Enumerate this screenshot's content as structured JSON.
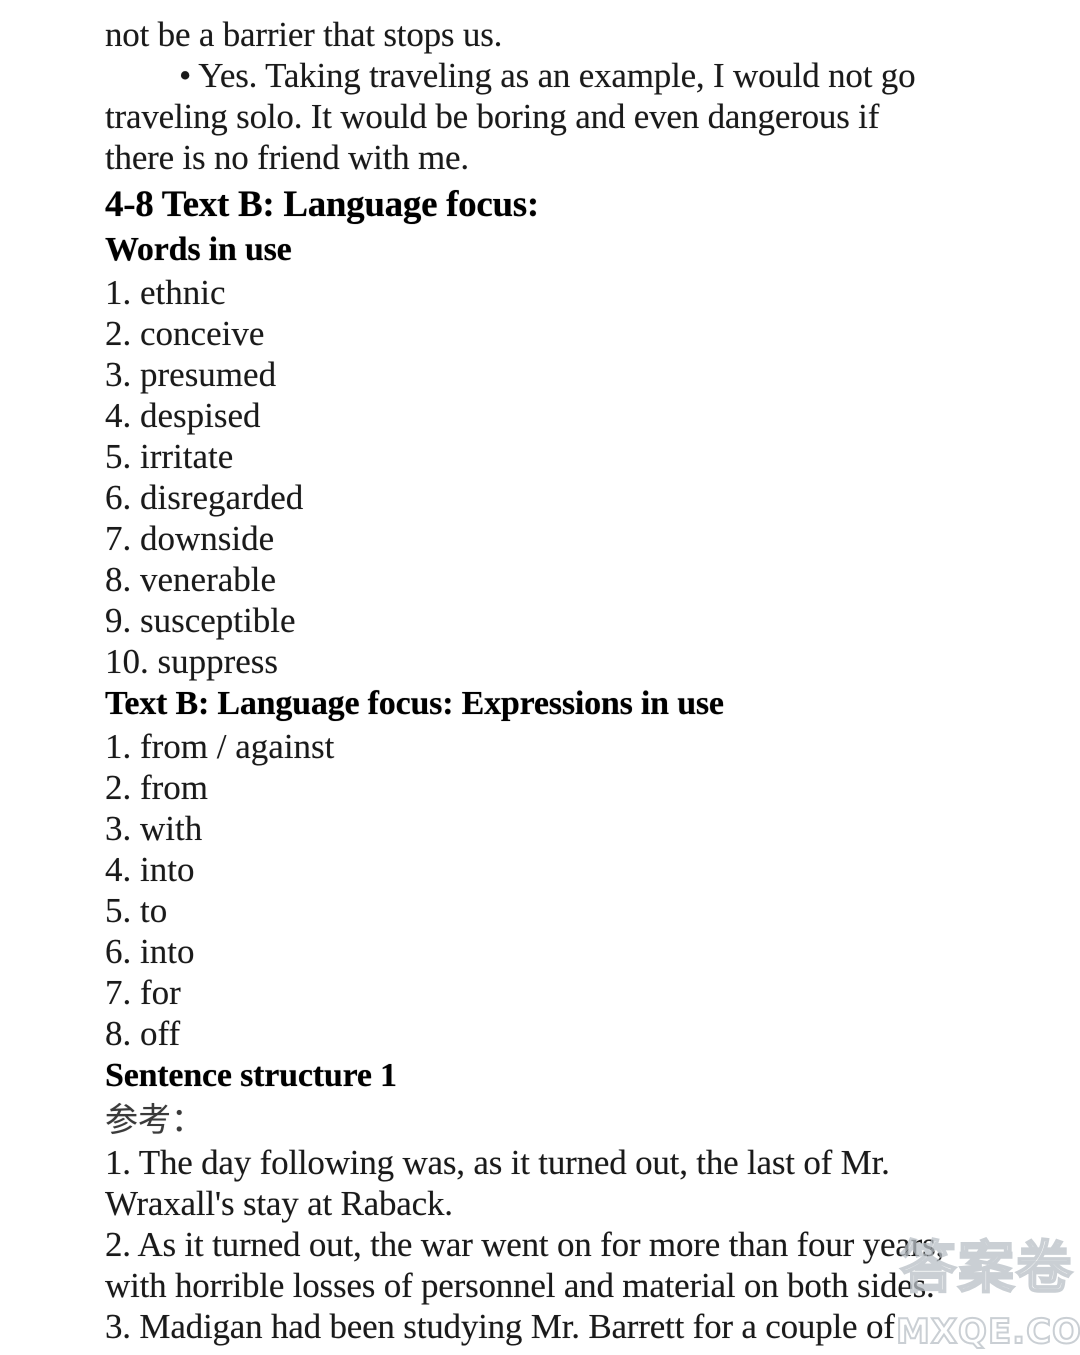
{
  "document": {
    "continued_paragraph": {
      "line1": "not be a barrier that stops us.",
      "bullet_line": "• Yes. Taking traveling as an example, I would not go",
      "line3": "traveling solo. It would be boring and even dangerous if",
      "line4": "there is no friend with me."
    },
    "section_heading": "4-8 Text B: Language focus:",
    "words_in_use": {
      "heading": "Words in use",
      "items": [
        "1. ethnic",
        "2. conceive",
        "3. presumed",
        "4. despised",
        "5. irritate",
        "6. disregarded",
        "7. downside",
        "8. venerable",
        "9. susceptible",
        "10. suppress"
      ]
    },
    "expressions_in_use": {
      "heading": "Text B: Language focus: Expressions in use",
      "items": [
        "1. from / against",
        "2. from",
        "3. with",
        "4. into",
        "5. to",
        "6. into",
        "7. for",
        "8. off"
      ]
    },
    "sentence_structure": {
      "heading": "Sentence structure 1",
      "note": "参考：",
      "answers": [
        {
          "line1": "1. The day following was, as it turned out, the last of Mr.",
          "line2": "Wraxall's stay at Raback."
        },
        {
          "line1": "2. As it turned out, the war went on for more than four years,",
          "line2": "with horrible losses of personnel and material on both sides."
        },
        {
          "line1": "3. Madigan had been studying Mr. Barrett for a couple of",
          "line2": ""
        }
      ]
    }
  },
  "watermark": {
    "cjk": "答案卷",
    "domain": "MXQE.COM",
    "color": "#b9c0c6"
  }
}
